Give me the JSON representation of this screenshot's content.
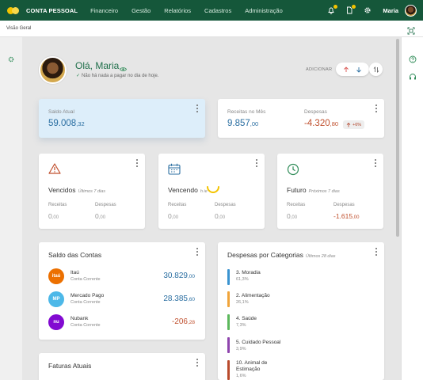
{
  "topbar": {
    "brand": "CONTA PESSOAL",
    "nav": [
      "Financeiro",
      "Gestão",
      "Relatórios",
      "Cadastros",
      "Administração"
    ],
    "user": "Maria"
  },
  "subbar": {
    "crumb": "Visão Geral"
  },
  "greeting": {
    "title": "Olá, Maria",
    "subtitle": "Não há nada a pagar no dia de hoje.",
    "add_label": "ADICIONAR"
  },
  "saldo": {
    "label": "Saldo Atual",
    "int": "59.008",
    "dec": ",32"
  },
  "mes": {
    "receitas_label": "Receitas no Mês",
    "receitas_int": "9.857",
    "receitas_dec": ",00",
    "despesas_label": "Despesas",
    "despesas_int": "-4.320",
    "despesas_dec": ",80",
    "badge": "+6%"
  },
  "minis": [
    {
      "title": "Vencidos",
      "sub": "Últimos 7 dias",
      "rec_label": "Receitas",
      "rec_int": "0",
      "rec_dec": ",00",
      "desp_label": "Despesas",
      "desp_int": "0",
      "desp_dec": ",00"
    },
    {
      "title": "Vencendo",
      "sub": "h  ie",
      "rec_label": "Receitas",
      "rec_int": "0",
      "rec_dec": ",00",
      "desp_label": "Despesas",
      "desp_int": "0",
      "desp_dec": ",00"
    },
    {
      "title": "Futuro",
      "sub": "Próximos 7 dias",
      "rec_label": "Receitas",
      "rec_int": "0",
      "rec_dec": ",00",
      "desp_label": "Despesas",
      "desp_int": "-1.615",
      "desp_dec": ",00"
    }
  ],
  "contas": {
    "title": "Saldo das Contas",
    "items": [
      {
        "name": "Itaú",
        "type": "Conta Corrente",
        "int": "30.829",
        "dec": ",00",
        "color": "#ec7000",
        "logo": "itaú"
      },
      {
        "name": "Mercado Pago",
        "type": "Conta Corrente",
        "int": "28.385",
        "dec": ",60",
        "color": "#4db8e8",
        "logo": "MP"
      },
      {
        "name": "Nubank",
        "type": "Conta Corrente",
        "int": "-206",
        "dec": ",28",
        "color": "#820ad1",
        "logo": "nu"
      }
    ]
  },
  "categorias": {
    "title": "Despesas por Categorias",
    "sub": "Últimos 28 dias",
    "items": [
      {
        "name": "3. Moradia",
        "pct": "61,3%",
        "color": "#3a93d0"
      },
      {
        "name": "2. Alimentação",
        "pct": "26,1%",
        "color": "#f0a43a"
      },
      {
        "name": "4. Saúde",
        "pct": "7,3%",
        "color": "#5cb85c"
      },
      {
        "name": "5. Cuidado Pessoal",
        "pct": "3,9%",
        "color": "#8e44ad"
      },
      {
        "name": "10. Animal de Estimação",
        "pct": "1,6%",
        "color": "#b94a2c"
      }
    ]
  },
  "faturas": {
    "title": "Faturas Atuais"
  }
}
